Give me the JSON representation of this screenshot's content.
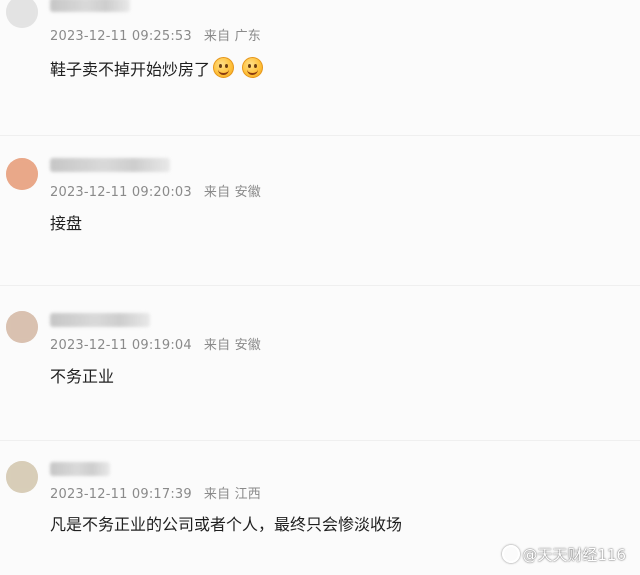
{
  "comments": [
    {
      "timestamp": "2023-12-11 09:25:53",
      "location": "来自 广东",
      "text": "鞋子卖不掉开始炒房了",
      "emojis": [
        "smile-emoji",
        "smile-emoji"
      ],
      "avatar_color": "#e3e3e3"
    },
    {
      "timestamp": "2023-12-11 09:20:03",
      "location": "来自 安徽",
      "text": "接盘",
      "emojis": [],
      "avatar_color": "#e9a889"
    },
    {
      "timestamp": "2023-12-11 09:19:04",
      "location": "来自 安徽",
      "text": "不务正业",
      "emojis": [],
      "avatar_color": "#d9c1b0"
    },
    {
      "timestamp": "2023-12-11 09:17:39",
      "location": "来自 江西",
      "text": "凡是不务正业的公司或者个人，最终只会惨淡收场",
      "emojis": [],
      "avatar_color": "#d8cdb8"
    }
  ],
  "watermark": "@天天财经116",
  "colors": {
    "background": "#fbfbfb",
    "meta_text": "#8a8a8a",
    "body_text": "#1f1f1f"
  }
}
